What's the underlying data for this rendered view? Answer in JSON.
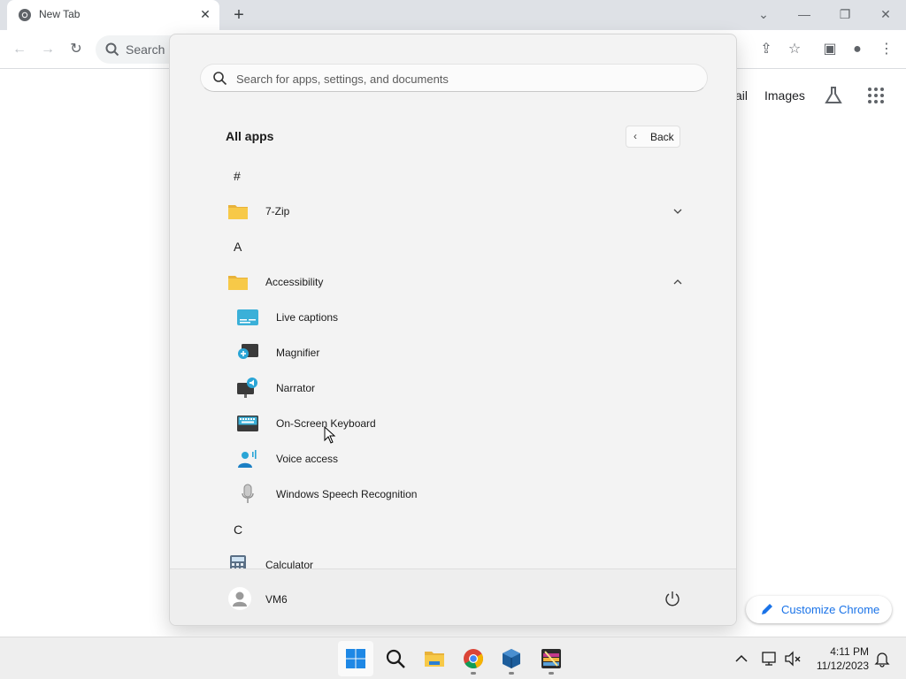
{
  "browser": {
    "tab_title": "New Tab",
    "omnibox_placeholder": "Search Google or type a URL",
    "omnibox_visible_text": "Search G",
    "links": {
      "gmail": "ail",
      "images": "Images"
    },
    "customize_label": "Customize Chrome"
  },
  "start_menu": {
    "search_placeholder": "Search for apps, settings, and documents",
    "all_apps_title": "All apps",
    "back_label": "Back",
    "sections": [
      {
        "letter": "#"
      },
      {
        "app": "7-Zip",
        "icon": "folder-icon",
        "expand": "chevron-down-icon"
      },
      {
        "letter": "A"
      },
      {
        "app": "Accessibility",
        "icon": "folder-icon",
        "expand": "chevron-up-icon"
      },
      {
        "app": "Live captions",
        "icon": "live-captions-icon"
      },
      {
        "app": "Magnifier",
        "icon": "magnifier-icon"
      },
      {
        "app": "Narrator",
        "icon": "narrator-icon"
      },
      {
        "app": "On-Screen Keyboard",
        "icon": "keyboard-icon"
      },
      {
        "app": "Voice access",
        "icon": "voice-access-icon"
      },
      {
        "app": "Windows Speech Recognition",
        "icon": "microphone-icon"
      },
      {
        "letter": "C"
      },
      {
        "app": "Calculator",
        "icon": "calculator-icon"
      }
    ],
    "user_name": "VM6"
  },
  "taskbar": {
    "items": [
      "start-icon",
      "search-icon",
      "file-explorer-icon",
      "chrome-icon",
      "virtualbox-icon",
      "winrar-icon"
    ],
    "time": "4:11 PM",
    "date": "11/12/2023"
  },
  "colors": {
    "accent": "#0067c0",
    "folder": "#f7c948",
    "chrome_blue": "#1a73e8"
  }
}
